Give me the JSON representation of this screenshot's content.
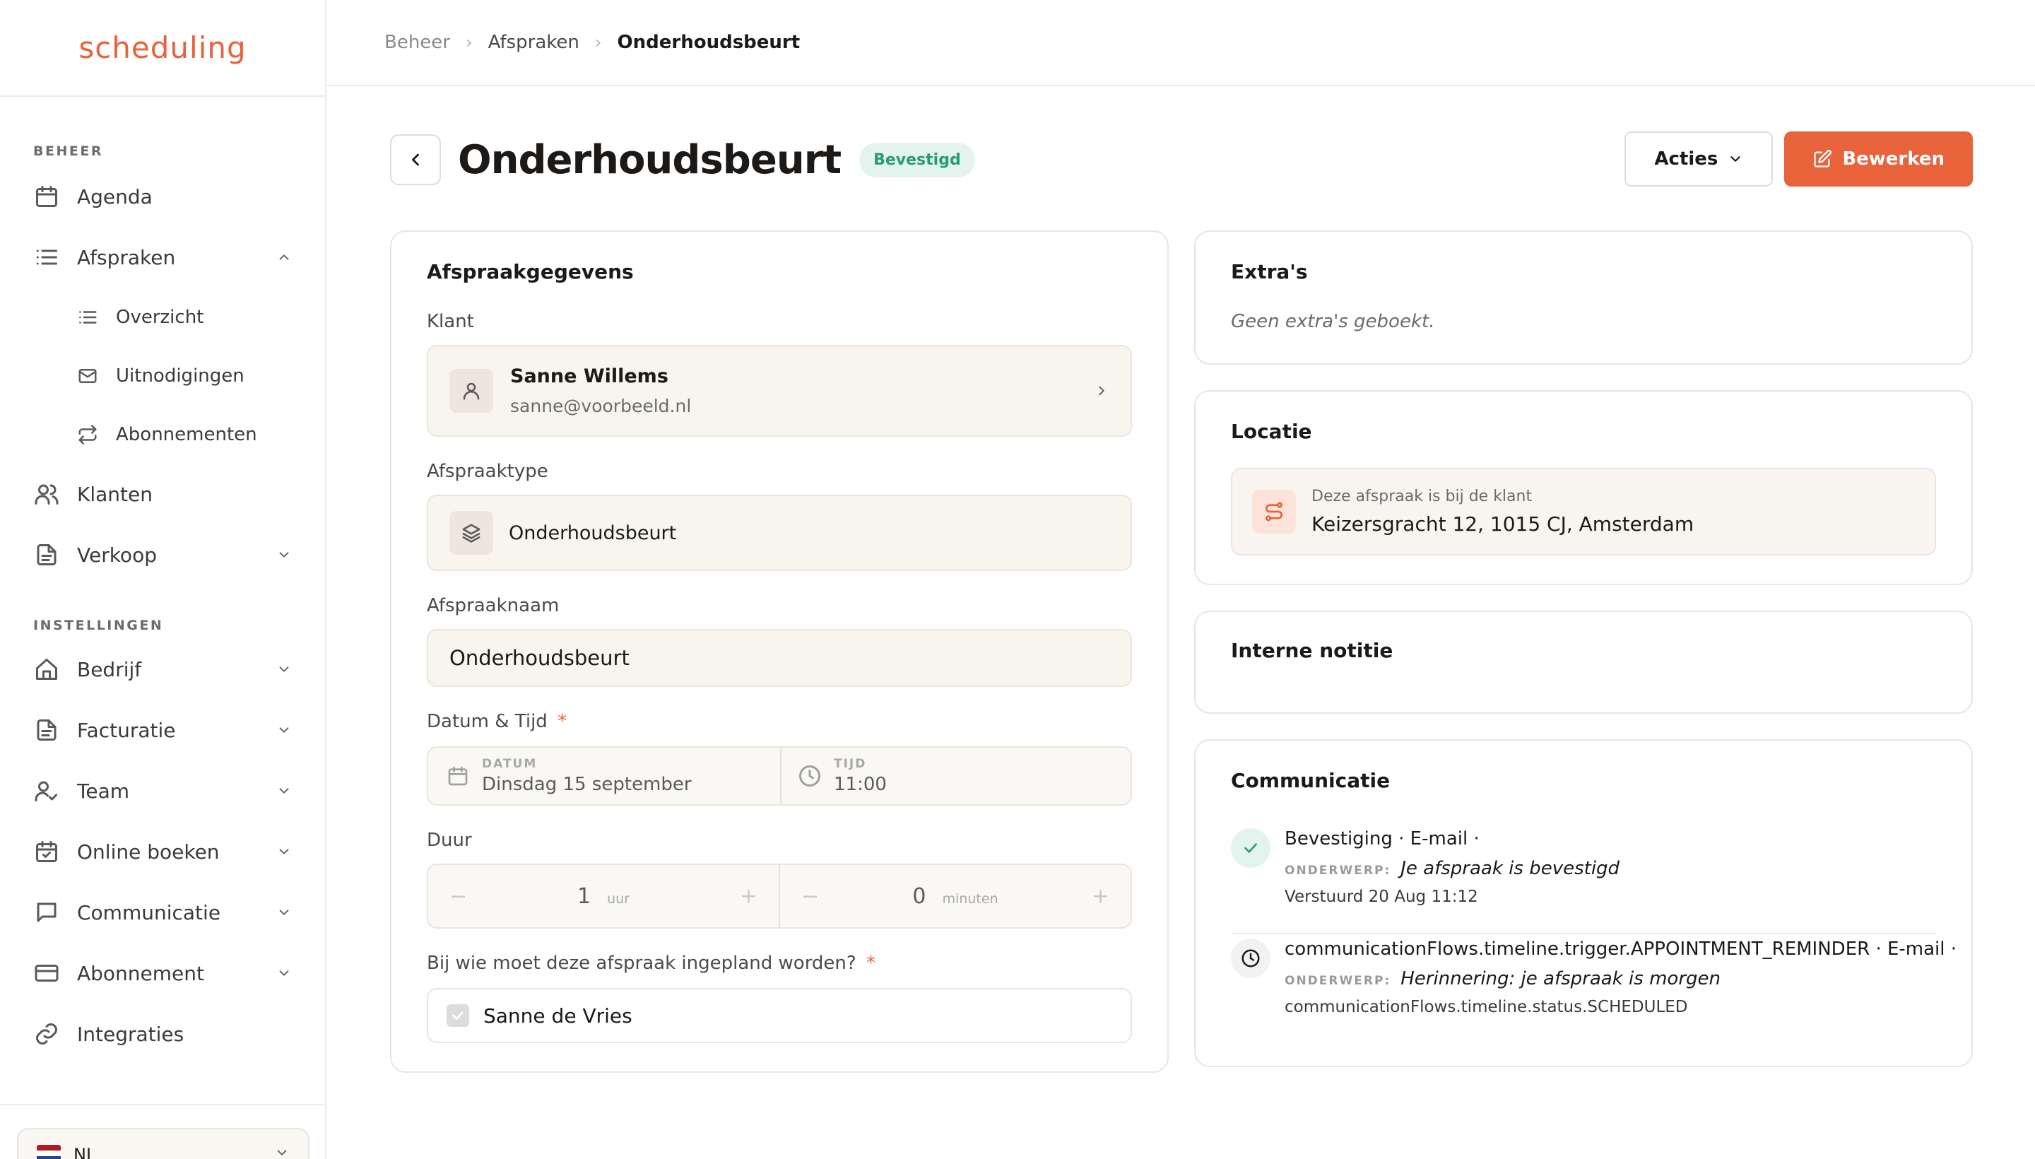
{
  "brand": {
    "logo_text": "scheduling",
    "accent": "#e8623a"
  },
  "sidebar": {
    "sections": [
      {
        "label": "BEHEER"
      },
      {
        "label": "INSTELLINGEN"
      }
    ],
    "items": {
      "agenda": "Agenda",
      "afspraken": "Afspraken",
      "overzicht": "Overzicht",
      "uitnodigingen": "Uitnodigingen",
      "abonnementen": "Abonnementen",
      "klanten": "Klanten",
      "verkoop": "Verkoop",
      "bedrijf": "Bedrijf",
      "facturatie": "Facturatie",
      "team": "Team",
      "online_boeken": "Online boeken",
      "communicatie": "Communicatie",
      "abonnement": "Abonnement",
      "integraties": "Integraties"
    },
    "language": "NL"
  },
  "breadcrumb": [
    "Beheer",
    "Afspraken",
    "Onderhoudsbeurt"
  ],
  "header": {
    "title": "Onderhoudsbeurt",
    "status": "Bevestigd",
    "actions_label": "Acties",
    "edit_label": "Bewerken"
  },
  "details": {
    "title": "Afspraakgegevens",
    "client_label": "Klant",
    "client_name": "Sanne Willems",
    "client_email": "sanne@voorbeeld.nl",
    "type_label": "Afspraaktype",
    "type_value": "Onderhoudsbeurt",
    "name_label": "Afspraaknaam",
    "name_value": "Onderhoudsbeurt",
    "datetime_label": "Datum & Tijd",
    "required_mark": "*",
    "date_caption": "DATUM",
    "date_value": "Dinsdag 15 september",
    "time_caption": "TIJD",
    "time_value": "11:00",
    "duration_label": "Duur",
    "hours_value": "1",
    "hours_unit": "uur",
    "minutes_value": "0",
    "minutes_unit": "minuten",
    "minus": "−",
    "plus": "+",
    "assign_label": "Bij wie moet deze afspraak ingepland worden?",
    "assignee": "Sanne de Vries"
  },
  "extras": {
    "title": "Extra's",
    "empty_text": "Geen extra's geboekt."
  },
  "location": {
    "title": "Locatie",
    "caption": "Deze afspraak is bij de klant",
    "address": "Keizersgracht 12, 1015 CJ, Amsterdam"
  },
  "notes": {
    "title": "Interne notitie"
  },
  "communication": {
    "title": "Communicatie",
    "items": [
      {
        "heading": "Bevestiging · E-mail ·",
        "subject_label": "ONDERWERP:",
        "subject": "Je afspraak is bevestigd",
        "status": "Verstuurd 20 Aug 11:12"
      },
      {
        "heading": "communicationFlows.timeline.trigger.APPOINTMENT_REMINDER · E-mail ·",
        "subject_label": "ONDERWERP:",
        "subject": "Herinnering: je afspraak is morgen",
        "status": "communicationFlows.timeline.status.SCHEDULED"
      }
    ]
  }
}
